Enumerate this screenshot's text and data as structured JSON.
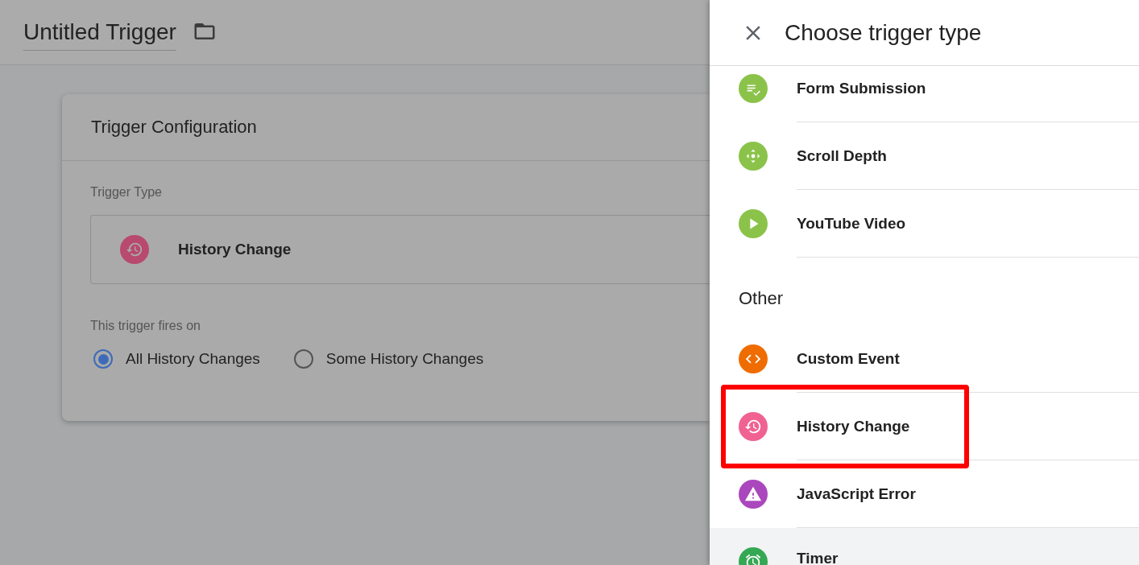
{
  "editor": {
    "title": "Untitled Trigger",
    "card": {
      "title": "Trigger Configuration",
      "type_label": "Trigger Type",
      "selected_type": {
        "label": "History Change",
        "kind": "history",
        "color": "#b8496f"
      },
      "fires_label": "This trigger fires on",
      "options": [
        {
          "label": "All History Changes",
          "selected": true
        },
        {
          "label": "Some History Changes",
          "selected": false
        }
      ]
    }
  },
  "panel": {
    "title": "Choose trigger type",
    "sections": [
      {
        "items": [
          {
            "label": "Form Submission",
            "kind": "form",
            "color": "#8bc34a",
            "highlighted": false,
            "hovered": false
          },
          {
            "label": "Scroll Depth",
            "kind": "scroll",
            "color": "#8bc34a",
            "highlighted": false,
            "hovered": false
          },
          {
            "label": "YouTube Video",
            "kind": "play",
            "color": "#8bc34a",
            "highlighted": false,
            "hovered": false
          }
        ]
      },
      {
        "heading": "Other",
        "items": [
          {
            "label": "Custom Event",
            "kind": "code",
            "color": "#ef6c00",
            "highlighted": false,
            "hovered": false
          },
          {
            "label": "History Change",
            "kind": "history",
            "color": "#f06292",
            "highlighted": true,
            "hovered": false
          },
          {
            "label": "JavaScript Error",
            "kind": "warning",
            "color": "#ab47bc",
            "highlighted": false,
            "hovered": false
          },
          {
            "label": "Timer",
            "kind": "alarm",
            "color": "#34a853",
            "highlighted": false,
            "hovered": true
          }
        ]
      }
    ]
  }
}
